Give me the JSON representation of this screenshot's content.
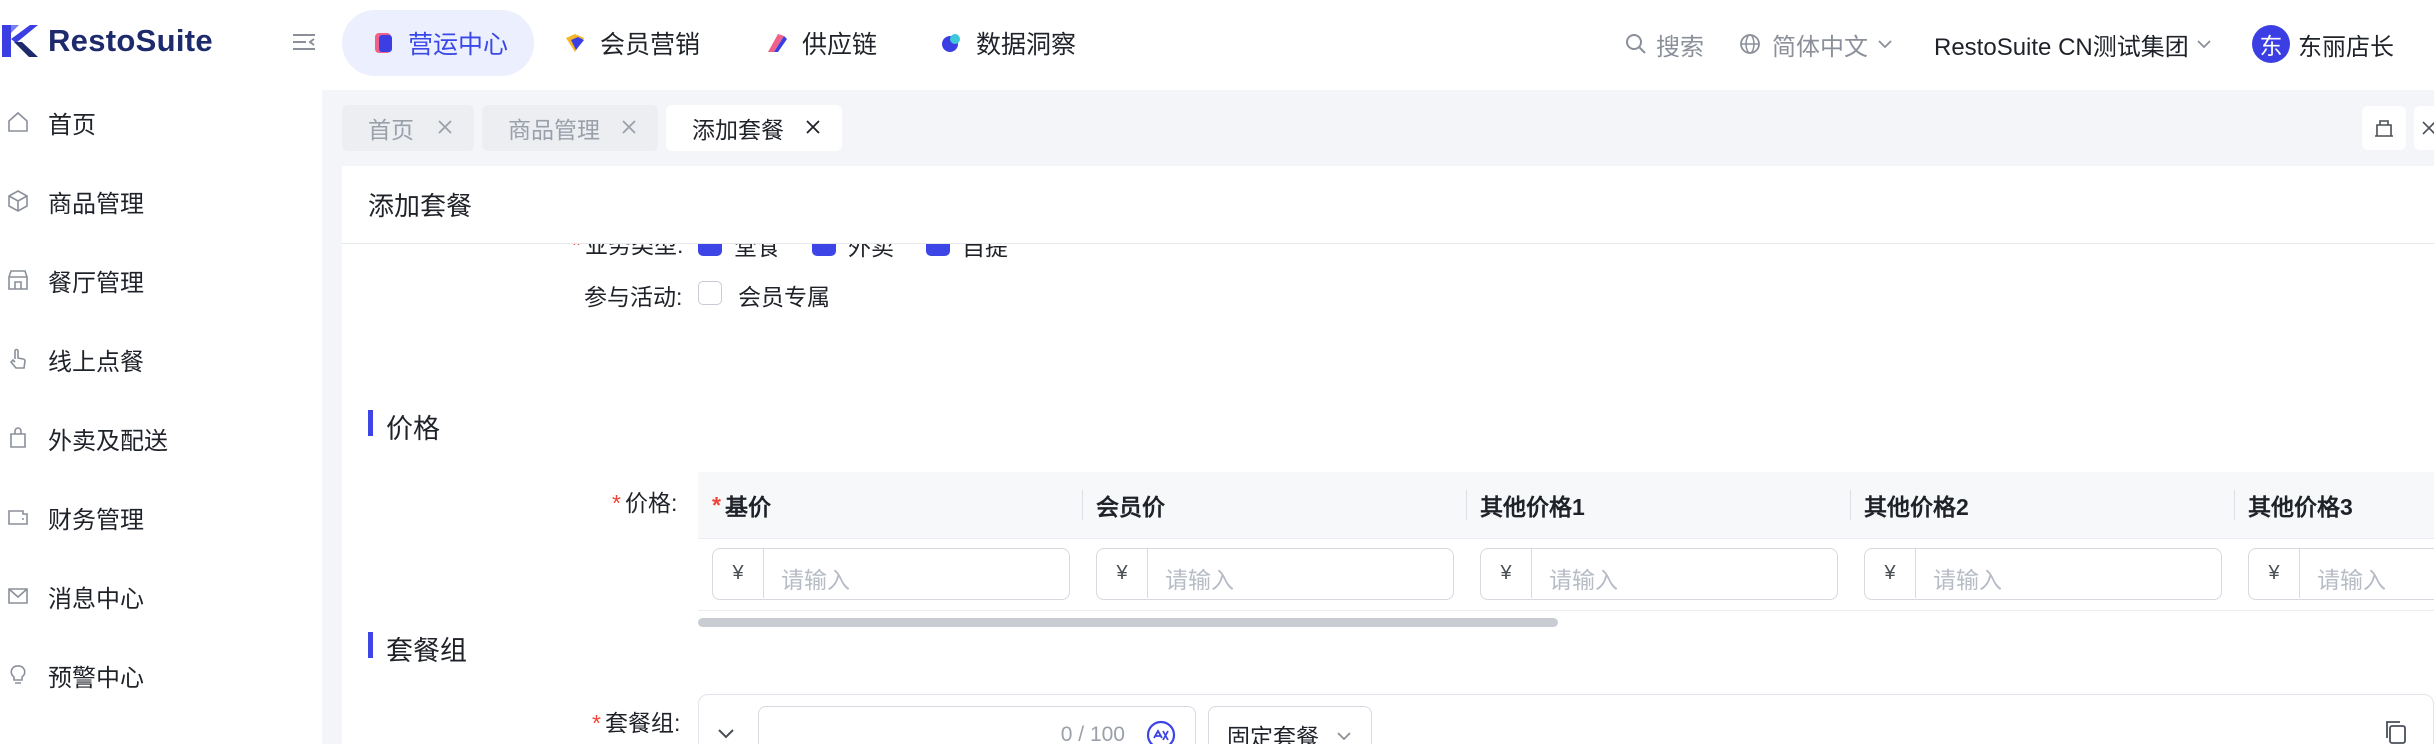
{
  "brand": {
    "name": "RestoSuite"
  },
  "nav": {
    "tabs": [
      {
        "label": "营运中心",
        "icon": "operations-icon",
        "active": true
      },
      {
        "label": "会员营销",
        "icon": "member-marketing-icon",
        "active": false
      },
      {
        "label": "供应链",
        "icon": "supply-chain-icon",
        "active": false
      },
      {
        "label": "数据洞察",
        "icon": "data-insights-icon",
        "active": false
      }
    ]
  },
  "header": {
    "search_label": "搜索",
    "language": "简体中文",
    "org": "RestoSuite CN测试集团",
    "user": {
      "avatar_text": "东",
      "name": "东丽店长"
    }
  },
  "sidebar": {
    "items": [
      {
        "label": "首页",
        "icon": "home-icon"
      },
      {
        "label": "商品管理",
        "icon": "product-cube-icon"
      },
      {
        "label": "餐厅管理",
        "icon": "store-icon"
      },
      {
        "label": "线上点餐",
        "icon": "tap-hand-icon"
      },
      {
        "label": "外卖及配送",
        "icon": "delivery-bag-icon"
      },
      {
        "label": "财务管理",
        "icon": "wallet-icon"
      },
      {
        "label": "消息中心",
        "icon": "mail-icon"
      },
      {
        "label": "预警中心",
        "icon": "bulb-icon"
      }
    ]
  },
  "page_tabs": [
    {
      "label": "首页",
      "active": false
    },
    {
      "label": "商品管理",
      "active": false
    },
    {
      "label": "添加套餐",
      "active": true
    }
  ],
  "form": {
    "title": "添加套餐",
    "business_type": {
      "label": "业务类型:",
      "options": [
        {
          "label": "堂食",
          "checked": true
        },
        {
          "label": "外卖",
          "checked": true
        },
        {
          "label": "自提",
          "checked": true
        }
      ]
    },
    "activity": {
      "label": "参与活动:",
      "options": [
        {
          "label": "会员专属",
          "checked": false
        }
      ]
    },
    "price_section": {
      "title": "价格",
      "field_label": "价格:",
      "columns": [
        {
          "label": "基价",
          "required": true
        },
        {
          "label": "会员价",
          "required": false
        },
        {
          "label": "其他价格1",
          "required": false
        },
        {
          "label": "其他价格2",
          "required": false
        },
        {
          "label": "其他价格3",
          "required": false
        }
      ],
      "currency_symbol": "¥",
      "input_placeholder": "请输入"
    },
    "group_section": {
      "title": "套餐组",
      "field_label": "套餐组:",
      "name_count": "0 / 100",
      "type_value": "固定套餐"
    }
  }
}
